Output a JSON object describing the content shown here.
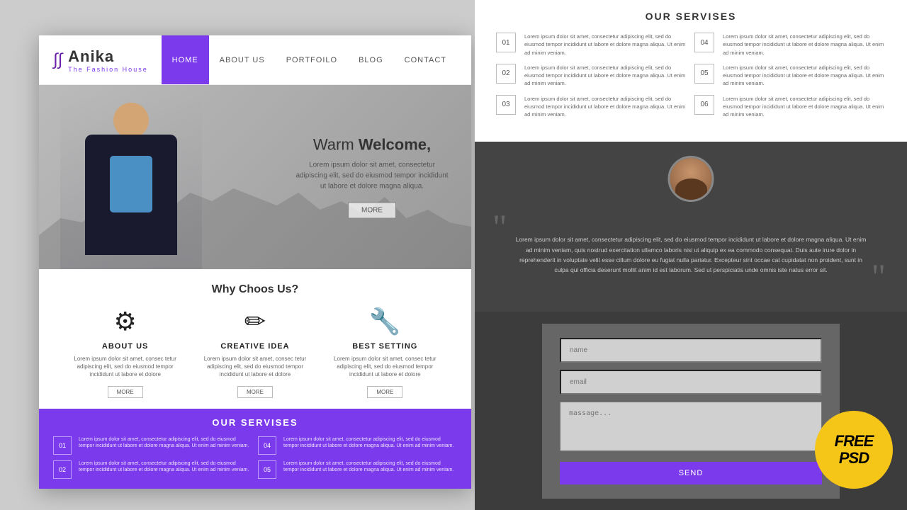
{
  "brand": {
    "name": "Anika",
    "tagline": "The Fashion House",
    "logo_symbol": "∫"
  },
  "nav": {
    "items": [
      {
        "label": "HOME",
        "active": true
      },
      {
        "label": "ABOUT US",
        "active": false
      },
      {
        "label": "PORTFOILO",
        "active": false
      },
      {
        "label": "BLOG",
        "active": false
      },
      {
        "label": "CONTACT",
        "active": false
      }
    ]
  },
  "hero": {
    "welcome_text": "Warm Welcome,",
    "welcome_bold": "Welcome,",
    "description": "Lorem ipsum dolor sit amet, consectetur adipiscing elit, sed do eiusmod tempor incididunt ut labore et dolore magna aliqua.",
    "button_label": "MORE"
  },
  "why_choose": {
    "title": "Why Choos Us?",
    "items": [
      {
        "icon": "⚙",
        "title": "ABOUT US",
        "desc": "Lorem ipsum dolor sit amet, consec tetur adipiscing elit, sed do eiusmod tempor incididunt ut labore et dolore",
        "button": "MORE"
      },
      {
        "icon": "✏",
        "title": "CREATIVE IDEA",
        "desc": "Lorem ipsum dolor sit amet, consec tetur adipiscing elit, sed do eiusmod tempor incididunt ut labore et dolore",
        "button": "MORE"
      },
      {
        "icon": "🔧",
        "title": "BEST SETTING",
        "desc": "Lorem ipsum dolor sit amet, consec tetur adipiscing elit, sed do eiusmod tempor incididunt ut labore et dolore",
        "button": "MORE"
      }
    ]
  },
  "services": {
    "title": "OUR SERVISES",
    "items": [
      {
        "num": "01",
        "text": "Lorem ipsum dolor sit amet, consectetur adipiscing elit, sed do eiusmod tempor incididunt ut labore et dolore magna aliqua. Ut enim ad minim veniam."
      },
      {
        "num": "02",
        "text": "Lorem ipsum dolor sit amet, consectetur adipiscing elit, sed do eiusmod tempor incididunt ut labore et dolore magna aliqua. Ut enim ad minim veniam."
      },
      {
        "num": "03",
        "text": "Lorem ipsum dolor sit amet, consectetur adipiscing elit, sed do eiusmod tempor incididunt ut labore et dolore magna aliqua. Ut enim ad minim veniam."
      },
      {
        "num": "04",
        "text": "Lorem ipsum dolor sit amet, consectetur adipiscing elit, sed do eiusmod tempor incididunt ut labore et dolore magna aliqua. Ut enim ad minim veniam."
      },
      {
        "num": "05",
        "text": "Lorem ipsum dolor sit amet, consectetur adipiscing elit, sed do eiusmod tempor incididunt ut labore et dolore magna aliqua. Ut enim ad minim veniam."
      },
      {
        "num": "06",
        "text": "Lorem ipsum dolor sit amet, consectetur adipiscing elit, sed do eiusmod tempor incididunt ut labore et dolore magna aliqua. Ut enim ad minim veniam."
      }
    ]
  },
  "testimonial": {
    "text": "Lorem ipsum dolor sit amet, consectetur adipiscing elit, sed do eiusmod tempor incididunt ut labore et dolore magna aliqua. Ut enim ad minim veniam, quis nostrud exercitation ullamco laboris nisi ut aliquip ex ea commodo consequat. Duis aute irure dolor in reprehenderit in voluptate velit esse cillum dolore eu fugiat nulla pariatur. Excepteur sint occae cat cupidatat non proident, sunt in culpa qui officia deserunt mollit anim id est laborum. Sed ut perspiciatis unde omnis iste natus error sit."
  },
  "contact": {
    "name_placeholder": "name",
    "email_placeholder": "email",
    "message_placeholder": "massage...",
    "send_label": "SEND"
  },
  "badge": {
    "line1": "FREE",
    "line2": "PSD"
  },
  "colors": {
    "purple": "#7c3aed",
    "dark_bg": "#444444",
    "form_bg": "#666666",
    "badge_yellow": "#f5c518"
  }
}
